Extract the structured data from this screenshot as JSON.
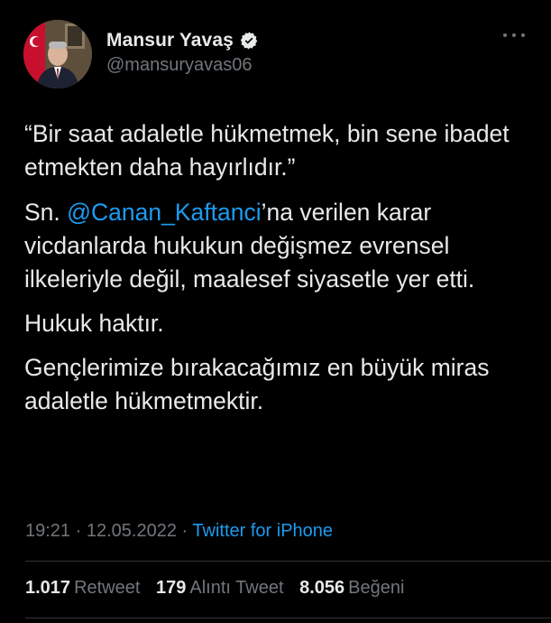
{
  "author": {
    "display_name": "Mansur Yavaş",
    "handle": "@mansuryavas06",
    "verified": true
  },
  "tweet": {
    "quote_line": "“Bir saat adaletle hükmetmek, bin sene ibadet etmekten daha hayırlıdır.”",
    "p2_prefix": "Sn. ",
    "p2_mention": "@Canan_Kaftanci",
    "p2_suffix": "’na verilen karar vicdanlarda hukukun değişmez evrensel ilkeleriyle değil, maalesef siyasetle yer etti.",
    "p3": "Hukuk haktır.",
    "p4": "Gençlerimize bırakacağımız en büyük miras adaletle hükmetmektir."
  },
  "meta": {
    "time": "19:21",
    "separator": "·",
    "date": "12.05.2022",
    "source": "Twitter for iPhone"
  },
  "stats": {
    "retweets": "1.017",
    "retweets_label": "Retweet",
    "quotes": "179",
    "quotes_label": "Alıntı Tweet",
    "likes": "8.056",
    "likes_label": "Beğeni"
  },
  "colors": {
    "background": "#000000",
    "text": "#e7e9ea",
    "secondary": "#71767b",
    "accent": "#1d9bf0",
    "divider": "#2f3336"
  },
  "icons": {
    "verified": "verified-badge-icon",
    "more": "more-options-icon"
  }
}
